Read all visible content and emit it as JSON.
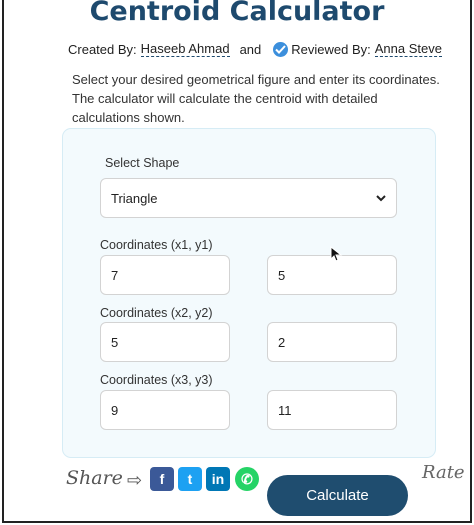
{
  "title": "Centroid Calculator",
  "byline": {
    "created_label": "Created By:",
    "author": "Haseeb Ahmad",
    "and": "and",
    "reviewed_label": "Reviewed By:",
    "reviewer": "Anna Steve"
  },
  "intro": "Select your desired geometrical figure and enter its coordinates. The calculator will calculate the centroid with detailed calculations shown.",
  "form": {
    "shape_label": "Select Shape",
    "shape_value": "Triangle",
    "c1_label": "Coordinates (x1, y1)",
    "x1": "7",
    "y1": "5",
    "c2_label": "Coordinates (x2, y2)",
    "x2": "5",
    "y2": "2",
    "c3_label": "Coordinates (x3, y3)",
    "x3": "9",
    "y3": "11"
  },
  "footer": {
    "share_label": "Share",
    "arrow": "⇨",
    "facebook_glyph": "f",
    "twitter_glyph": "t",
    "linkedin_glyph": "in",
    "whatsapp_glyph": "✆",
    "calculate_label": "Calculate",
    "rate_label": "Rate"
  },
  "colors": {
    "title": "#1e4a6e",
    "button": "#1f4d6f",
    "panel": "#f3fafd"
  }
}
